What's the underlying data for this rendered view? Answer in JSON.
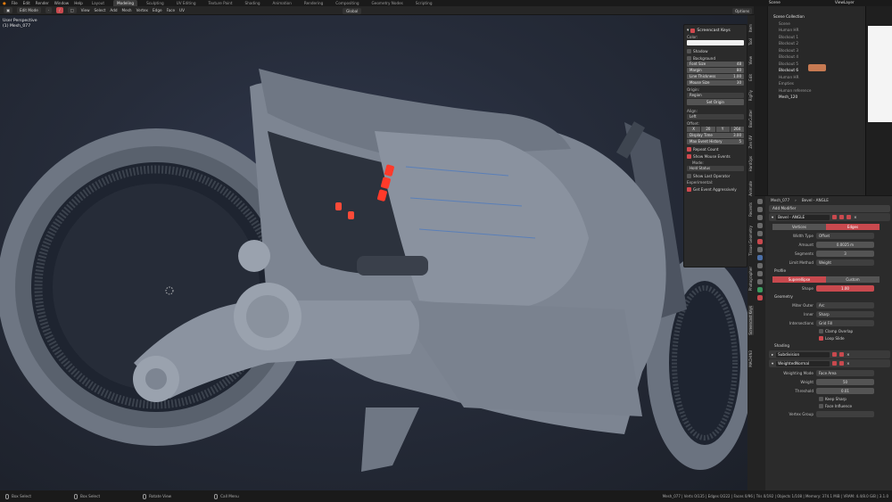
{
  "top_menu": [
    "File",
    "Edit",
    "Render",
    "Window",
    "Help"
  ],
  "workspaces": [
    {
      "label": "Layout",
      "active": false
    },
    {
      "label": "Modeling",
      "active": true
    },
    {
      "label": "Sculpting",
      "active": false
    },
    {
      "label": "UV Editing",
      "active": false
    },
    {
      "label": "Texture Paint",
      "active": false
    },
    {
      "label": "Shading",
      "active": false
    },
    {
      "label": "Animation",
      "active": false
    },
    {
      "label": "Rendering",
      "active": false
    },
    {
      "label": "Compositing",
      "active": false
    },
    {
      "label": "Geometry Nodes",
      "active": false
    },
    {
      "label": "Scripting",
      "active": false
    }
  ],
  "top_right": {
    "scene": "Scene",
    "view_layer": "ViewLayer"
  },
  "viewport_header": {
    "mode": "Edit Mode",
    "menus": [
      "View",
      "Select",
      "Add",
      "Mesh",
      "Vertex",
      "Edge",
      "Face",
      "UV"
    ],
    "orientation": "Global",
    "options": "Options"
  },
  "viewport_info": {
    "line1": "User Perspective",
    "line2": "(1) Mesh_077"
  },
  "screencast_keys": {
    "title": "Screencast Keys",
    "color_label": "Color:",
    "shadow": "Shadow",
    "background": "Background",
    "font_size": {
      "label": "Font Size",
      "value": "48"
    },
    "margin": {
      "label": "Margin",
      "value": "80"
    },
    "line_thickness": {
      "label": "Line Thickness",
      "value": "1.00"
    },
    "mouse_size": {
      "label": "Mouse Size",
      "value": "30"
    },
    "origin_label": "Origin:",
    "origin_value": "Region",
    "set_origin": "Set Origin",
    "align_label": "Align:",
    "align_value": "Left",
    "offset_label": "Offset:",
    "offset_values": [
      "X",
      "20",
      "Y",
      "264"
    ],
    "display_time": {
      "label": "Display Time",
      "value": "3.00"
    },
    "max_event_history": {
      "label": "Max Event History",
      "value": "5"
    },
    "repeat_count": "Repeat Count",
    "show_mouse_events": "Show Mouse Events",
    "mode_label": "Mode:",
    "mode_value": "Hold Status",
    "show_last_operator": "Show Last Operator",
    "experimental_label": "Experimental:",
    "get_event_aggressively": "Get Event Aggressively"
  },
  "side_tabs": [
    "Item",
    "Tool",
    "View",
    "Edit",
    "RigFly",
    "BoxCutter",
    "Zen UV",
    "HardOps",
    "Animate",
    "Recents",
    "Tissue Geometry",
    "Photographer",
    "Screencast Keys",
    "MACHIN3"
  ],
  "outliner": {
    "items": [
      "Scene Collection",
      "Scene",
      "Human HR",
      "Blockout 1",
      "Blockout 2",
      "Blockout 3",
      "Blockout 4",
      "Blockout 5",
      "Blockout 6",
      "Human HR",
      "Empties",
      "Human reference",
      "Mesh_120"
    ],
    "selected_index": 8
  },
  "properties": {
    "breadcrumb": [
      "Mesh_077",
      "Bevel - ANGLE"
    ],
    "add_modifier": "Add Modifier",
    "bevel_name": "Bevel - ANGLE",
    "affect": {
      "options": [
        "Vertices",
        "Edges"
      ],
      "selected": "Edges"
    },
    "width_type": {
      "label": "Width Type",
      "value": "Offset"
    },
    "amount": {
      "label": "Amount",
      "value": "0.0025 m"
    },
    "segments": {
      "label": "Segments",
      "value": "3"
    },
    "limit_method": {
      "label": "Limit Method",
      "value": "Weight"
    },
    "profile_header": "Profile",
    "profile_type": {
      "options": [
        "Superellipse",
        "Custom"
      ],
      "selected": "Superellipse"
    },
    "shape": {
      "label": "Shape",
      "value": "1.00"
    },
    "geometry_header": "Geometry",
    "miter_outer": {
      "label": "Miter Outer",
      "value": "Arc"
    },
    "inner": {
      "label": "Inner",
      "value": "Sharp"
    },
    "intersections": {
      "label": "Intersections",
      "value": "Grid Fill"
    },
    "clamp_overlap": "Clamp Overlap",
    "loop_slide": "Loop Slide",
    "shading_header": "Shading",
    "subdivision": "Subdivision",
    "weighted_normal": "WeightedNormal",
    "weighting_mode": {
      "label": "Weighting Mode",
      "value": "Face Area"
    },
    "weight": {
      "label": "Weight",
      "value": "50"
    },
    "threshold": {
      "label": "Threshold",
      "value": "0.01"
    },
    "keep_sharp": "Keep Sharp",
    "face_influence": "Face Influence",
    "vertex_group": {
      "label": "Vertex Group",
      "value": ""
    }
  },
  "statusbar": {
    "items": [
      "Box Select",
      "Box Select",
      "Rotate View",
      "Call Menu"
    ],
    "stats": "Mesh_077 | Verts 0/135 | Edges 0/222 | Faces 0/96 | Tris 0/192 | Objects 1/108 | Memory: 374.1 MiB | VRAM: 4.4/8.0 GiB | 3.1.0"
  },
  "colors": {
    "accent": "#c8494e",
    "select_blue": "#4b6fa8",
    "viewport_bg": "#262c3a",
    "model": "#7d8592",
    "emissive": "#ff3a2a"
  }
}
